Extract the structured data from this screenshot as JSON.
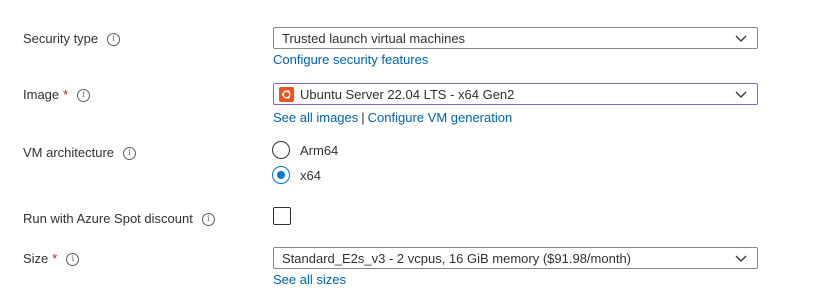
{
  "security_type": {
    "label": "Security type",
    "value": "Trusted launch virtual machines",
    "link": "Configure security features"
  },
  "image": {
    "label": "Image",
    "required_marker": "*",
    "value": "Ubuntu Server 22.04 LTS - x64 Gen2",
    "link_all_images": "See all images",
    "separator": "|",
    "link_configure_generation": "Configure VM generation"
  },
  "vm_architecture": {
    "label": "VM architecture",
    "options": [
      {
        "label": "Arm64",
        "selected": false
      },
      {
        "label": "x64",
        "selected": true
      }
    ]
  },
  "spot_discount": {
    "label": "Run with Azure Spot discount",
    "checked": false
  },
  "size": {
    "label": "Size",
    "required_marker": "*",
    "value": "Standard_E2s_v3 - 2 vcpus, 16 GiB memory ($91.98/month)",
    "link": "See all sizes"
  },
  "icons": {
    "info": "info-icon",
    "chevron": "chevron-down-icon",
    "image_logo": "ubuntu-icon"
  },
  "colors": {
    "link": "#0062ad",
    "required": "#a4262c",
    "radio_selected": "#0078d4",
    "ubuntu": "#e95420",
    "focused_border": "#8764b8"
  }
}
